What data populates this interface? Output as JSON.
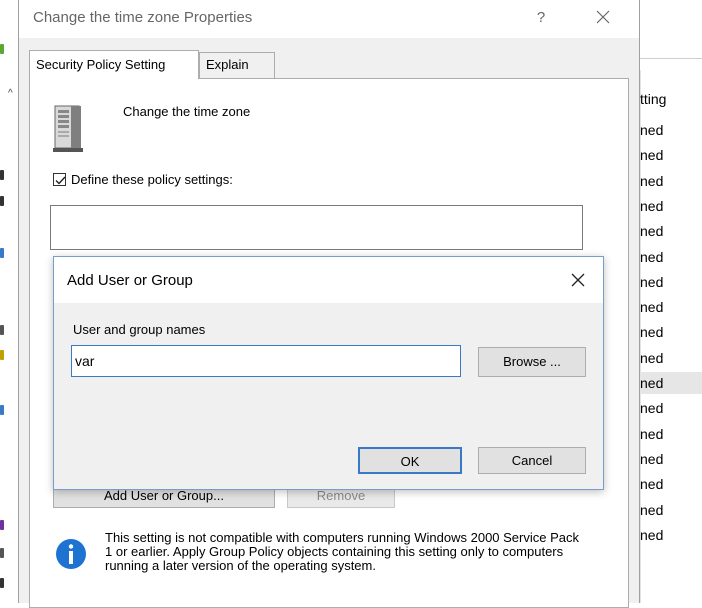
{
  "background": {
    "column_header": "tting",
    "rows": [
      "ned",
      "ned",
      "ned",
      "ned",
      "ned",
      "ned",
      "ned",
      "ned",
      "ned",
      "ned",
      "ned",
      "ned",
      "ned",
      "ned",
      "ned",
      "ned",
      "ned"
    ],
    "selected_row_index": 10
  },
  "properties_dialog": {
    "title": "Change the time zone Properties",
    "help_label": "?",
    "close_icon": "close-icon",
    "tabs": [
      {
        "label": "Security Policy Setting",
        "active": true
      },
      {
        "label": "Explain",
        "active": false
      }
    ],
    "policy_name": "Change the time zone",
    "policy_icon": "server-icon",
    "define_checkbox": {
      "label": "Define these policy settings:",
      "checked": true
    },
    "add_button": "Add User or Group...",
    "remove_button": "Remove",
    "info_icon": "info-icon",
    "info_text": "This setting is not compatible with computers running Windows 2000 Service Pack 1 or earlier.  Apply Group Policy objects containing this setting only to computers running a later version of the operating system."
  },
  "add_user_dialog": {
    "title": "Add User or Group",
    "close_icon": "close-icon",
    "names_label": "User and group names",
    "names_value": "var",
    "browse_button": "Browse ...",
    "ok_button": "OK",
    "cancel_button": "Cancel"
  },
  "colors": {
    "accent_border": "#3a78c8",
    "dialog_bg": "#f0f0f0",
    "button_bg": "#e1e1e1",
    "info_blue": "#1e73d2",
    "selected_row": "#e6e6e6"
  }
}
